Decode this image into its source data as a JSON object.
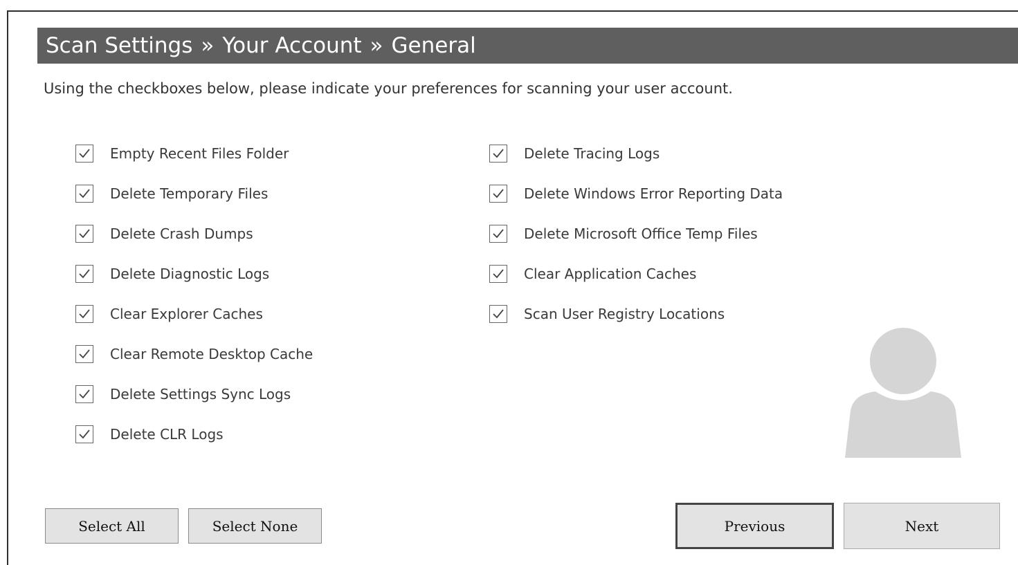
{
  "header": {
    "crumb1": "Scan Settings",
    "sep1": "»",
    "crumb2": "Your Account",
    "sep2": "»",
    "crumb3": "General"
  },
  "instructions": "Using the checkboxes below, please indicate your preferences for scanning your user account.",
  "options_left": [
    {
      "label": "Empty Recent Files Folder",
      "checked": true
    },
    {
      "label": "Delete Temporary Files",
      "checked": true
    },
    {
      "label": "Delete Crash Dumps",
      "checked": true
    },
    {
      "label": "Delete Diagnostic Logs",
      "checked": true
    },
    {
      "label": "Clear Explorer Caches",
      "checked": true
    },
    {
      "label": "Clear Remote Desktop Cache",
      "checked": true
    },
    {
      "label": "Delete Settings Sync Logs",
      "checked": true
    },
    {
      "label": "Delete CLR Logs",
      "checked": true
    }
  ],
  "options_right": [
    {
      "label": "Delete Tracing Logs",
      "checked": true
    },
    {
      "label": "Delete Windows Error Reporting Data",
      "checked": true
    },
    {
      "label": "Delete Microsoft Office Temp Files",
      "checked": true
    },
    {
      "label": "Clear Application Caches",
      "checked": true
    },
    {
      "label": "Scan User Registry Locations",
      "checked": true
    }
  ],
  "icons": {
    "checkmark": "check-icon",
    "avatar": "user-avatar-icon"
  },
  "buttons": {
    "select_all": "Select All",
    "select_none": "Select None",
    "previous": "Previous",
    "next": "Next"
  },
  "colors": {
    "titlebar_bg": "#5f5f5f",
    "titlebar_text": "#ffffff",
    "avatar": "#d5d5d5",
    "button_bg": "#e3e3e3"
  }
}
